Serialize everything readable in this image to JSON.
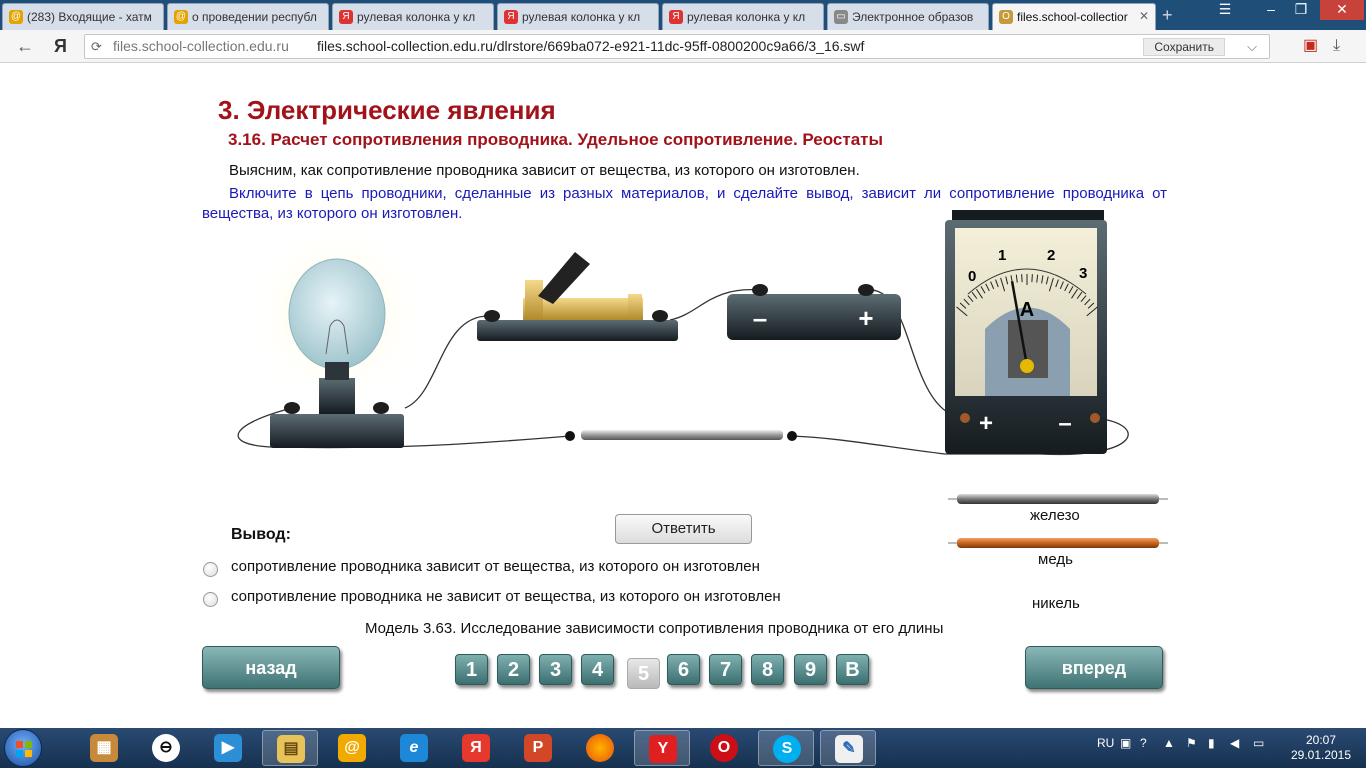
{
  "tabs": [
    {
      "label": "(283) Входящие - хатм",
      "icon_color": "#e3a300"
    },
    {
      "label": "о проведении республ",
      "icon_color": "#e3a300"
    },
    {
      "label": "рулевая колонка у кл",
      "icon_color": "#d33"
    },
    {
      "label": "рулевая колонка у кл",
      "icon_color": "#d33"
    },
    {
      "label": "рулевая колонка у кл",
      "icon_color": "#d33"
    },
    {
      "label": "Электронное образов",
      "icon_color": "#888"
    },
    {
      "label": "files.school-collectior",
      "icon_color": "#c49a3b"
    }
  ],
  "window_controls": {
    "menu": "☰",
    "minimize": "–",
    "maximize": "❐",
    "close": "✕"
  },
  "browser": {
    "back_icon": "arrow-left-icon",
    "yandex_logo": "Я",
    "url_domain": "files.school-collection.edu.ru",
    "url_path": "files.school-collection.edu.ru/dlrstore/669ba072-e921-11dc-95ff-0800200c9a66/3_16.swf",
    "save_label": "Сохранить"
  },
  "page": {
    "title": "3. Электрические явления",
    "subtitle": "3.16. Расчет сопротивления проводника. Удельное сопротивление. Реостаты",
    "intro": "Выясним, как сопротивление проводника зависит от вещества, из которого он изготовлен.",
    "task": "Включите в цепь проводники, сделанные из разных материалов, и сделайте вывод, зависит ли сопротивление проводника от вещества, из которого он изготовлен.",
    "ammeter": {
      "scale": [
        "0",
        "1",
        "2",
        "3"
      ],
      "unit": "A",
      "reading": 1.2,
      "plus": "+",
      "minus": "–"
    },
    "battery": {
      "minus": "–",
      "plus": "+"
    },
    "materials": [
      {
        "name": "железо",
        "color": "#8a8a8a"
      },
      {
        "name": "медь",
        "color": "#c8641e"
      },
      {
        "name": "никель",
        "color": "#b0b0b0"
      }
    ],
    "conclusion_label": "Вывод:",
    "answer_button": "Ответить",
    "options": [
      "сопротивление проводника зависит от вещества, из которого он изготовлен",
      "сопротивление проводника не зависит от вещества, из которого он изготовлен"
    ],
    "caption": "Модель 3.63. Исследование зависимости сопротивления проводника от его длины",
    "back_button": "назад",
    "forward_button": "вперед",
    "pages": [
      "1",
      "2",
      "3",
      "4",
      "5",
      "6",
      "7",
      "8",
      "9",
      "В"
    ],
    "current_page": "5"
  },
  "taskbar": {
    "apps": [
      {
        "icon": "start-icon",
        "label": ""
      },
      {
        "icon": "archive-icon",
        "label": ""
      },
      {
        "icon": "opera-o-icon",
        "label": ""
      },
      {
        "icon": "media-player-icon",
        "label": ""
      },
      {
        "icon": "explorer-icon",
        "label": ""
      },
      {
        "icon": "mail-icon",
        "label": "@"
      },
      {
        "icon": "ie-icon",
        "label": "e"
      },
      {
        "icon": "yandex-icon",
        "label": "Я"
      },
      {
        "icon": "powerpoint-icon",
        "label": "P"
      },
      {
        "icon": "firefox-icon",
        "label": ""
      },
      {
        "icon": "yandex-browser-icon",
        "label": "Y"
      },
      {
        "icon": "opera-icon",
        "label": "O"
      },
      {
        "icon": "skype-icon",
        "label": "S"
      },
      {
        "icon": "paint-icon",
        "label": ""
      }
    ],
    "lang": "RU",
    "time": "20:07",
    "date": "29.01.2015"
  }
}
